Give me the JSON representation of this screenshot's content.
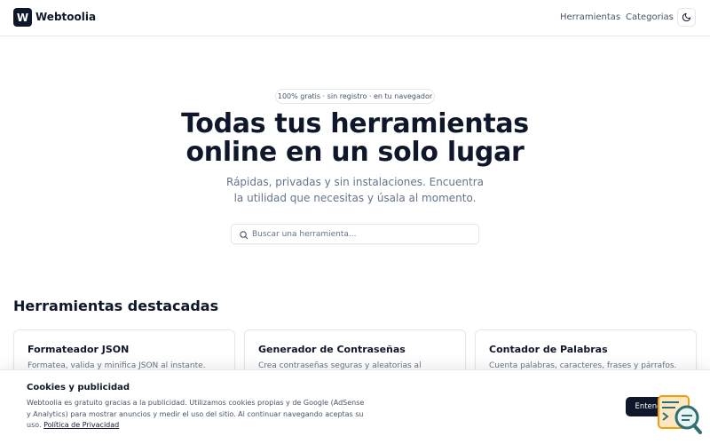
{
  "header": {
    "logo_letter": "W",
    "brand": "Webtoolia",
    "nav": [
      {
        "label": "Herramientas"
      },
      {
        "label": "Categorias"
      }
    ],
    "theme_icon": "moon-icon"
  },
  "hero": {
    "pill": "100% gratis · sin registro · en tu navegador",
    "title_line1": "Todas tus herramientas",
    "title_line2": "online en un solo lugar",
    "subtitle_line1": "Rápidas, privadas y sin instalaciones. Encuentra",
    "subtitle_line2": "la utilidad que necesitas y úsala al momento.",
    "search_placeholder": "Buscar una herramienta...",
    "search_icon": "search-icon"
  },
  "featured": {
    "title": "Herramientas destacadas",
    "cards": [
      {
        "title": "Formateador JSON",
        "desc": "Formatea, valida y minifica JSON al instante."
      },
      {
        "title": "Generador de Contraseñas",
        "desc": "Crea contraseñas seguras y aleatorias al"
      },
      {
        "title": "Contador de Palabras",
        "desc": "Cuenta palabras, caracteres, frases y párrafos."
      }
    ]
  },
  "cookie": {
    "title": "Cookies y publicidad",
    "line1": "Webtoolia es gratuito gracias a la publicidad. Utilizamos cookies propias y de Google (AdSense",
    "line2": "y Analytics) para mostrar anuncios y medir el uso del sitio. Al continuar navegando aceptas su",
    "line3_prefix": "uso.",
    "link": "Política de Privacidad",
    "accept": "Entendido"
  },
  "colors": {
    "primary": "#0f172a",
    "muted": "#64748b",
    "border": "#e5e7eb",
    "accent_orange": "#f59e0b",
    "accent_teal": "#2f6f73"
  }
}
